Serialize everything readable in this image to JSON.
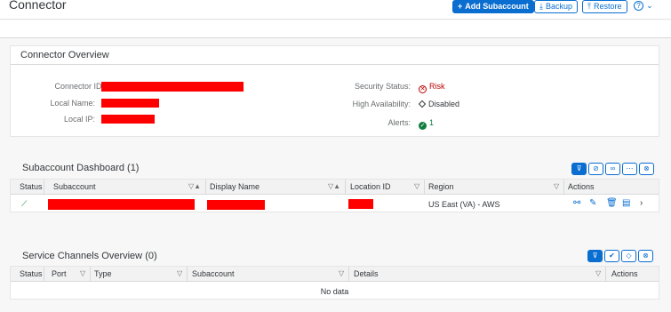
{
  "header": {
    "title": "Connector",
    "add_subaccount": "Add Subaccount",
    "backup": "Backup",
    "restore": "Restore",
    "help": "?",
    "help_menu": "⌄"
  },
  "overview": {
    "title": "Connector Overview",
    "connector_id_label": "Connector ID:",
    "local_name_label": "Local Name:",
    "local_ip_label": "Local IP:",
    "security_status_label": "Security Status:",
    "security_status_value": "Risk",
    "high_availability_label": "High Availability:",
    "high_availability_value": "Disabled",
    "alerts_label": "Alerts:",
    "alerts_value": "1"
  },
  "subaccount_dashboard": {
    "title": "Subaccount Dashboard",
    "count": "(1)",
    "columns": [
      "Status",
      "Subaccount",
      "Display Name",
      "Location ID",
      "Region",
      "Actions"
    ],
    "rows": [
      {
        "region": "US East (VA) - AWS"
      }
    ]
  },
  "service_channels": {
    "title": "Service Channels Overview",
    "count": "(0)",
    "columns": [
      "Status",
      "Port",
      "Type",
      "Subaccount",
      "Details",
      "Actions"
    ],
    "empty_text": "No data"
  },
  "colors": {
    "accent": "#0a6ed1",
    "risk": "#bb0000",
    "success": "#107e3e",
    "redaction": "#ff0000"
  }
}
